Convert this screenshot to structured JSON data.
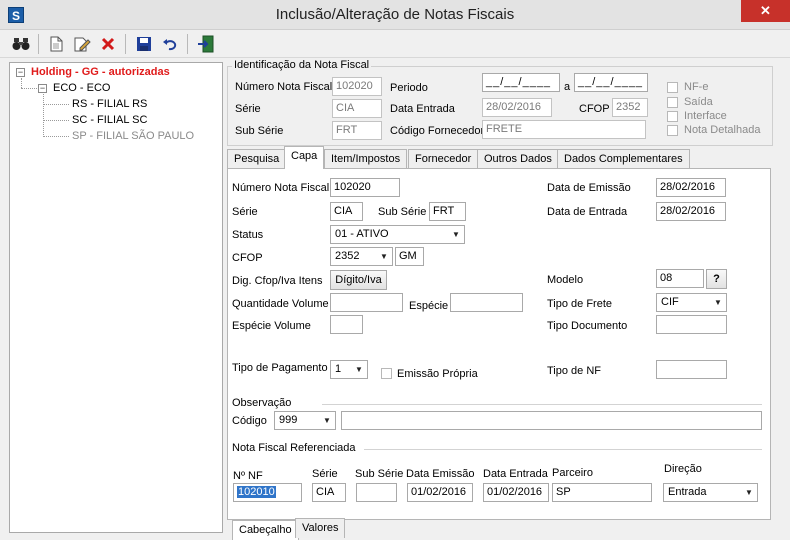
{
  "window": {
    "app_icon": "S",
    "title": "Inclusão/Alteração de Notas Fiscais",
    "close_label": "✕"
  },
  "toolbar": {
    "icons": [
      "binoculars-icon",
      "new-doc-icon",
      "edit-icon",
      "delete-icon",
      "save-icon",
      "undo-icon",
      "exit-icon"
    ]
  },
  "tree": {
    "root": "Holding -  GG -  autorizadas",
    "group": "ECO - ECO",
    "items": [
      "RS - FILIAL RS",
      "SC - FILIAL SC",
      "SP - FILIAL SÃO PAULO"
    ]
  },
  "ident": {
    "title": "Identificação da Nota Fiscal",
    "numero_label": "Número Nota Fiscal",
    "numero_value": "102020",
    "serie_label": "Série",
    "serie_value": "CIA",
    "subserie_label": "Sub Série",
    "subserie_value": "FRT",
    "periodo_label": "Periodo",
    "periodo_from": "__/__/____",
    "periodo_sep": "a",
    "periodo_to": "__/__/____",
    "data_entrada_label": "Data Entrada",
    "data_entrada_value": "28/02/2016",
    "cfop_label": "CFOP",
    "cfop_value": "2352",
    "cod_fornec_label": "Código Fornecedor",
    "cod_fornec_value": "FRETE",
    "checks": [
      "NF-e",
      "Saída",
      "Interface",
      "Nota Detalhada"
    ]
  },
  "tabs": [
    "Pesquisa",
    "Capa",
    "Item/Impostos",
    "Fornecedor",
    "Outros Dados",
    "Dados Complementares"
  ],
  "capa": {
    "numero_label": "Número Nota Fiscal",
    "numero_value": "102020",
    "serie_label": "Série",
    "serie_value": "CIA",
    "subserie_label": "Sub Série",
    "subserie_value": "FRT",
    "status_label": "Status",
    "status_value": "01 - ATIVO",
    "cfop_label": "CFOP",
    "cfop_value": "2352",
    "cfop_extra": "GM",
    "dig_label": "Dig. Cfop/Iva Itens",
    "dig_button": "Dígito/Iva",
    "qtd_volume_label": "Quantidade Volume",
    "especie_label": "Espécie",
    "especie_volume_label": "Espécie Volume",
    "tipo_pagamento_label": "Tipo de Pagamento",
    "tipo_pagamento_value": "1",
    "emissao_propria_label": "Emissão Própria",
    "data_emissao_label": "Data de Emissão",
    "data_emissao_value": "28/02/2016",
    "data_entrada_label": "Data de Entrada",
    "data_entrada_value": "28/02/2016",
    "modelo_label": "Modelo",
    "modelo_value": "08",
    "modelo_help": "?",
    "tipo_frete_label": "Tipo de Frete",
    "tipo_frete_value": "CIF",
    "tipo_documento_label": "Tipo Documento",
    "tipo_nf_label": "Tipo de NF",
    "observacao_label": "Observação",
    "codigo_label": "Código",
    "codigo_value": "999",
    "nf_ref_label": "Nota Fiscal Referenciada",
    "ref_cols": [
      "Nº NF",
      "Série",
      "Sub Série",
      "Data Emissão",
      "Data Entrada",
      "Parceiro",
      "Direção"
    ],
    "ref_values": {
      "nf": "102010",
      "serie": "CIA",
      "subserie": "",
      "emissao": "01/02/2016",
      "entrada": "01/02/2016",
      "parceiro": "SP",
      "direcao": "Entrada"
    }
  },
  "bottom_tabs": [
    "Cabeçalho",
    "Valores"
  ]
}
